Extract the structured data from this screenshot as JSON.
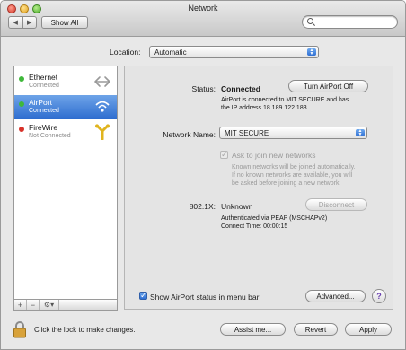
{
  "window": {
    "title": "Network"
  },
  "toolbar": {
    "back": "◀",
    "forward": "▶",
    "show_all": "Show All",
    "search_placeholder": ""
  },
  "location": {
    "label": "Location:",
    "value": "Automatic"
  },
  "services": [
    {
      "name": "Ethernet",
      "status": "Connected",
      "dot_color": "#3fb83a",
      "icon": "ethernet-arrows-icon"
    },
    {
      "name": "AirPort",
      "status": "Connected",
      "dot_color": "#3fb83a",
      "icon": "wifi-icon"
    },
    {
      "name": "FireWire",
      "status": "Not Connected",
      "dot_color": "#d8322a",
      "icon": "firewire-icon"
    }
  ],
  "sidebar_tools": {
    "add": "+",
    "remove": "−",
    "gear": "⚙▾"
  },
  "detail": {
    "status_label": "Status:",
    "status_value": "Connected",
    "turn_off_button": "Turn AirPort Off",
    "status_desc_line1": "AirPort is connected to MIT SECURE and has",
    "status_desc_line2": "the IP address 18.189.122.183.",
    "network_name_label": "Network Name:",
    "network_name_value": "MIT SECURE",
    "ask_join_label": "Ask to join new networks",
    "ask_join_desc_line1": "Known networks will be joined automatically.",
    "ask_join_desc_line2": "If no known networks are available, you will",
    "ask_join_desc_line3": "be asked before joining a new network.",
    "dot1x_label": "802.1X:",
    "dot1x_value": "Unknown",
    "disconnect_button": "Disconnect",
    "auth_line1": "Authenticated via PEAP (MSCHAPv2)",
    "auth_line2": "Connect Time: 00:00:15",
    "show_status_label": "Show AirPort status in menu bar",
    "advanced_button": "Advanced...",
    "help": "?"
  },
  "footer": {
    "lock_text": "Click the lock to make changes.",
    "assist_button": "Assist me...",
    "revert_button": "Revert",
    "apply_button": "Apply"
  },
  "colors": {
    "selection": "#2d6ccf",
    "connected": "#3fb83a",
    "not_connected": "#d8322a"
  }
}
